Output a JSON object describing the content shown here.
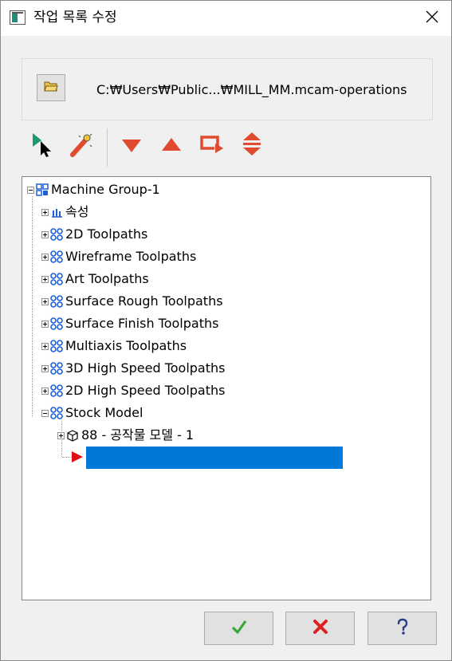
{
  "window": {
    "title": "작업 목록 수정",
    "icons": {
      "app": "window-app-icon",
      "close": "close-icon"
    }
  },
  "path_panel": {
    "folder_button_icon": "open-folder-icon",
    "path": "C:₩Users₩Public...₩MILL_MM.mcam-operations"
  },
  "toolbar": {
    "buttons": [
      {
        "name": "select-pointer-icon"
      },
      {
        "name": "magic-wand-icon"
      },
      {
        "name": "move-down-icon"
      },
      {
        "name": "move-up-icon"
      },
      {
        "name": "loop-arrow-icon"
      },
      {
        "name": "expand-collapse-icon"
      }
    ]
  },
  "tree": {
    "root": {
      "label": "Machine Group-1",
      "icon": "machine-group-icon"
    },
    "items": [
      {
        "label": "속성",
        "icon": "properties-icon"
      },
      {
        "label": "2D Toolpaths",
        "icon": "toolpath-group-icon"
      },
      {
        "label": "Wireframe Toolpaths",
        "icon": "toolpath-group-icon"
      },
      {
        "label": "Art Toolpaths",
        "icon": "toolpath-group-icon"
      },
      {
        "label": "Surface Rough Toolpaths",
        "icon": "toolpath-group-icon"
      },
      {
        "label": "Surface Finish Toolpaths",
        "icon": "toolpath-group-icon"
      },
      {
        "label": "Multiaxis Toolpaths",
        "icon": "toolpath-group-icon"
      },
      {
        "label": "3D High Speed Toolpaths",
        "icon": "toolpath-group-icon"
      },
      {
        "label": "2D High Speed Toolpaths",
        "icon": "toolpath-group-icon"
      },
      {
        "label": "Stock Model",
        "icon": "toolpath-group-icon"
      }
    ],
    "stock_child": {
      "label": "88 - 공작물 모델 - 1",
      "icon": "stock-model-icon"
    },
    "insert_marker_icon": "insert-arrow-icon",
    "edit_value": ""
  },
  "footer": {
    "ok_icon": "checkmark-icon",
    "cancel_icon": "cancel-x-icon",
    "help_icon": "help-question-icon"
  },
  "colors": {
    "selection": "#0078d7",
    "accent_red": "#e04a2e",
    "ok_green": "#3aa63a",
    "tree_icon_blue": "#1e5fd8"
  }
}
